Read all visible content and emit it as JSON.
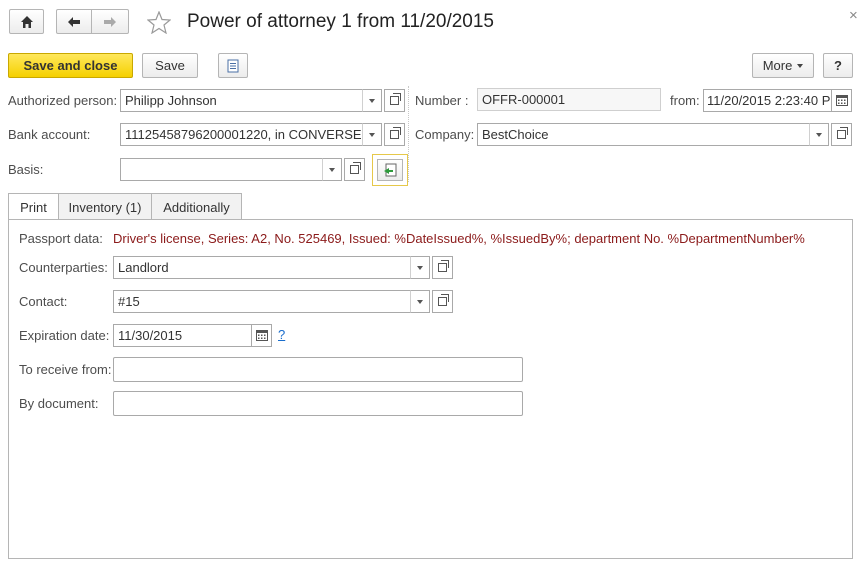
{
  "header": {
    "title": "Power of attorney 1 from 11/20/2015",
    "close_glyph": "×"
  },
  "toolbar": {
    "save_and_close_label": "Save and close",
    "save_label": "Save",
    "more_label": "More",
    "help_label": "?"
  },
  "form": {
    "authorized_person": {
      "label": "Authorized person:",
      "value": "Philipp Johnson"
    },
    "bank_account": {
      "label": "Bank account:",
      "value": "11125458796200001220, in CONVERSE"
    },
    "basis": {
      "label": "Basis:",
      "value": ""
    },
    "number": {
      "label": "Number :",
      "value": "OFFR-000001"
    },
    "from": {
      "label": "from:",
      "value": "11/20/2015  2:23:40 P"
    },
    "company": {
      "label": "Company:",
      "value": "BestChoice"
    }
  },
  "tabs": [
    {
      "label": "Print",
      "active": true
    },
    {
      "label": "Inventory (1)",
      "active": false
    },
    {
      "label": "Additionally",
      "active": false
    }
  ],
  "print_tab": {
    "passport_data": {
      "label": "Passport data:",
      "value": "Driver's license,  Series: A2, No. 525469, Issued: %DateIssued%, %IssuedBy%; department No. %DepartmentNumber%"
    },
    "counterparties": {
      "label": "Counterparties:",
      "value": "Landlord"
    },
    "contact": {
      "label": "Contact:",
      "value": "#15"
    },
    "expiration_date": {
      "label": "Expiration date:",
      "value": "11/30/2015",
      "help": "?"
    },
    "to_receive_from": {
      "label": "To receive from:",
      "value": ""
    },
    "by_document": {
      "label": "By document:",
      "value": ""
    }
  },
  "colors": {
    "accent_yellow": "#f5d000",
    "passport_text": "#8b1a1a",
    "help_link": "#1a6dcc"
  }
}
